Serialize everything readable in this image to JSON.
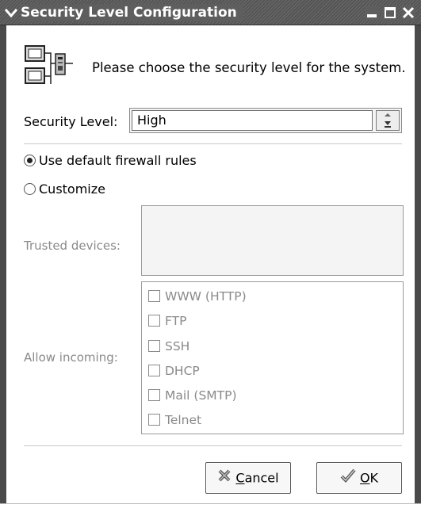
{
  "window": {
    "title": "Security Level Configuration",
    "controls": [
      "minimize-icon",
      "maximize-icon",
      "close-icon"
    ]
  },
  "header": {
    "text": "Please choose the security level for the system."
  },
  "security_level": {
    "label": "Security Level:",
    "selected": "High"
  },
  "firewall": {
    "options": [
      {
        "label": "Use default firewall rules",
        "checked": true
      },
      {
        "label": "Customize",
        "checked": false
      }
    ]
  },
  "trusted_devices": {
    "label": "Trusted devices:",
    "items": []
  },
  "allow_incoming": {
    "label": "Allow incoming:",
    "services": [
      {
        "label": "WWW (HTTP)",
        "checked": false
      },
      {
        "label": "FTP",
        "checked": false
      },
      {
        "label": "SSH",
        "checked": false
      },
      {
        "label": "DHCP",
        "checked": false
      },
      {
        "label": "Mail (SMTP)",
        "checked": false
      },
      {
        "label": "Telnet",
        "checked": false
      }
    ]
  },
  "buttons": {
    "cancel": {
      "mnemonic": "C",
      "rest": "ancel",
      "icon": "cancel-x-icon"
    },
    "ok": {
      "mnemonic": "O",
      "rest": "K",
      "icon": "checkmark-icon"
    }
  },
  "colors": {
    "titlebar": "#5e5e5e",
    "disabled_text": "#8a8a8a",
    "window_border": "#4a4a4a"
  }
}
